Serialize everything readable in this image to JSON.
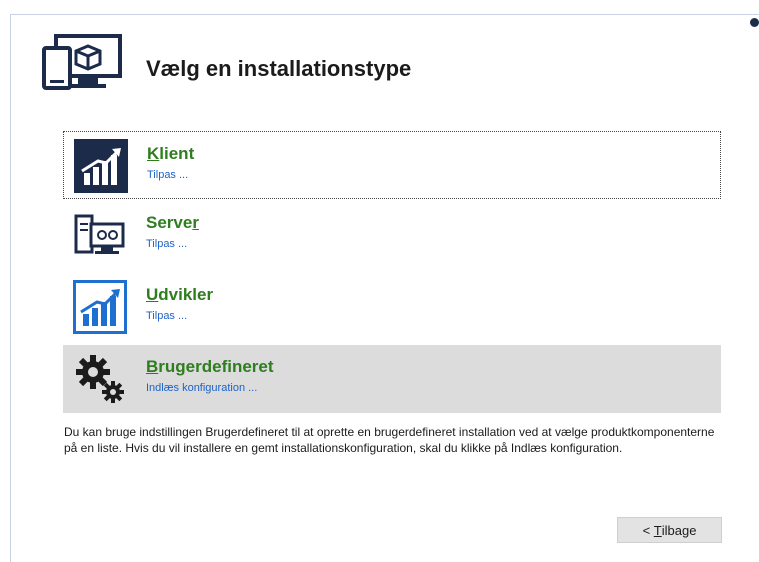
{
  "header": {
    "title": "Vælg en installationstype",
    "icon": "monitor-package-icon"
  },
  "options": [
    {
      "icon": "chart-up-icon",
      "title_key": "K",
      "title_rest": "lient",
      "sub": "Tilpas ..."
    },
    {
      "icon": "server-gear-icon",
      "title_pre": "Serve",
      "title_key": "r",
      "sub": "Tilpas ..."
    },
    {
      "icon": "chart-up-icon",
      "title_key": "U",
      "title_rest": "dvikler",
      "sub": "Tilpas ..."
    },
    {
      "icon": "gears-icon",
      "title_key": "B",
      "title_rest": "rugerdefineret",
      "sub": "Indlæs konfiguration ..."
    }
  ],
  "description": "Du kan bruge indstillingen Brugerdefineret til at oprette en brugerdefineret installation ved at vælge produktkomponenterne på en liste. Hvis du vil installere en gemt installationskonfiguration, skal du klikke på Indlæs konfiguration.",
  "footer": {
    "back_prefix": "< ",
    "back_key": "T",
    "back_rest": "ilbage"
  },
  "colors": {
    "accent_green": "#2e7d1e",
    "link_blue": "#1e62c7",
    "icon_navy": "#1c2b49",
    "icon_blue": "#1e6fcf",
    "selected_bg": "#dcdcdc"
  }
}
